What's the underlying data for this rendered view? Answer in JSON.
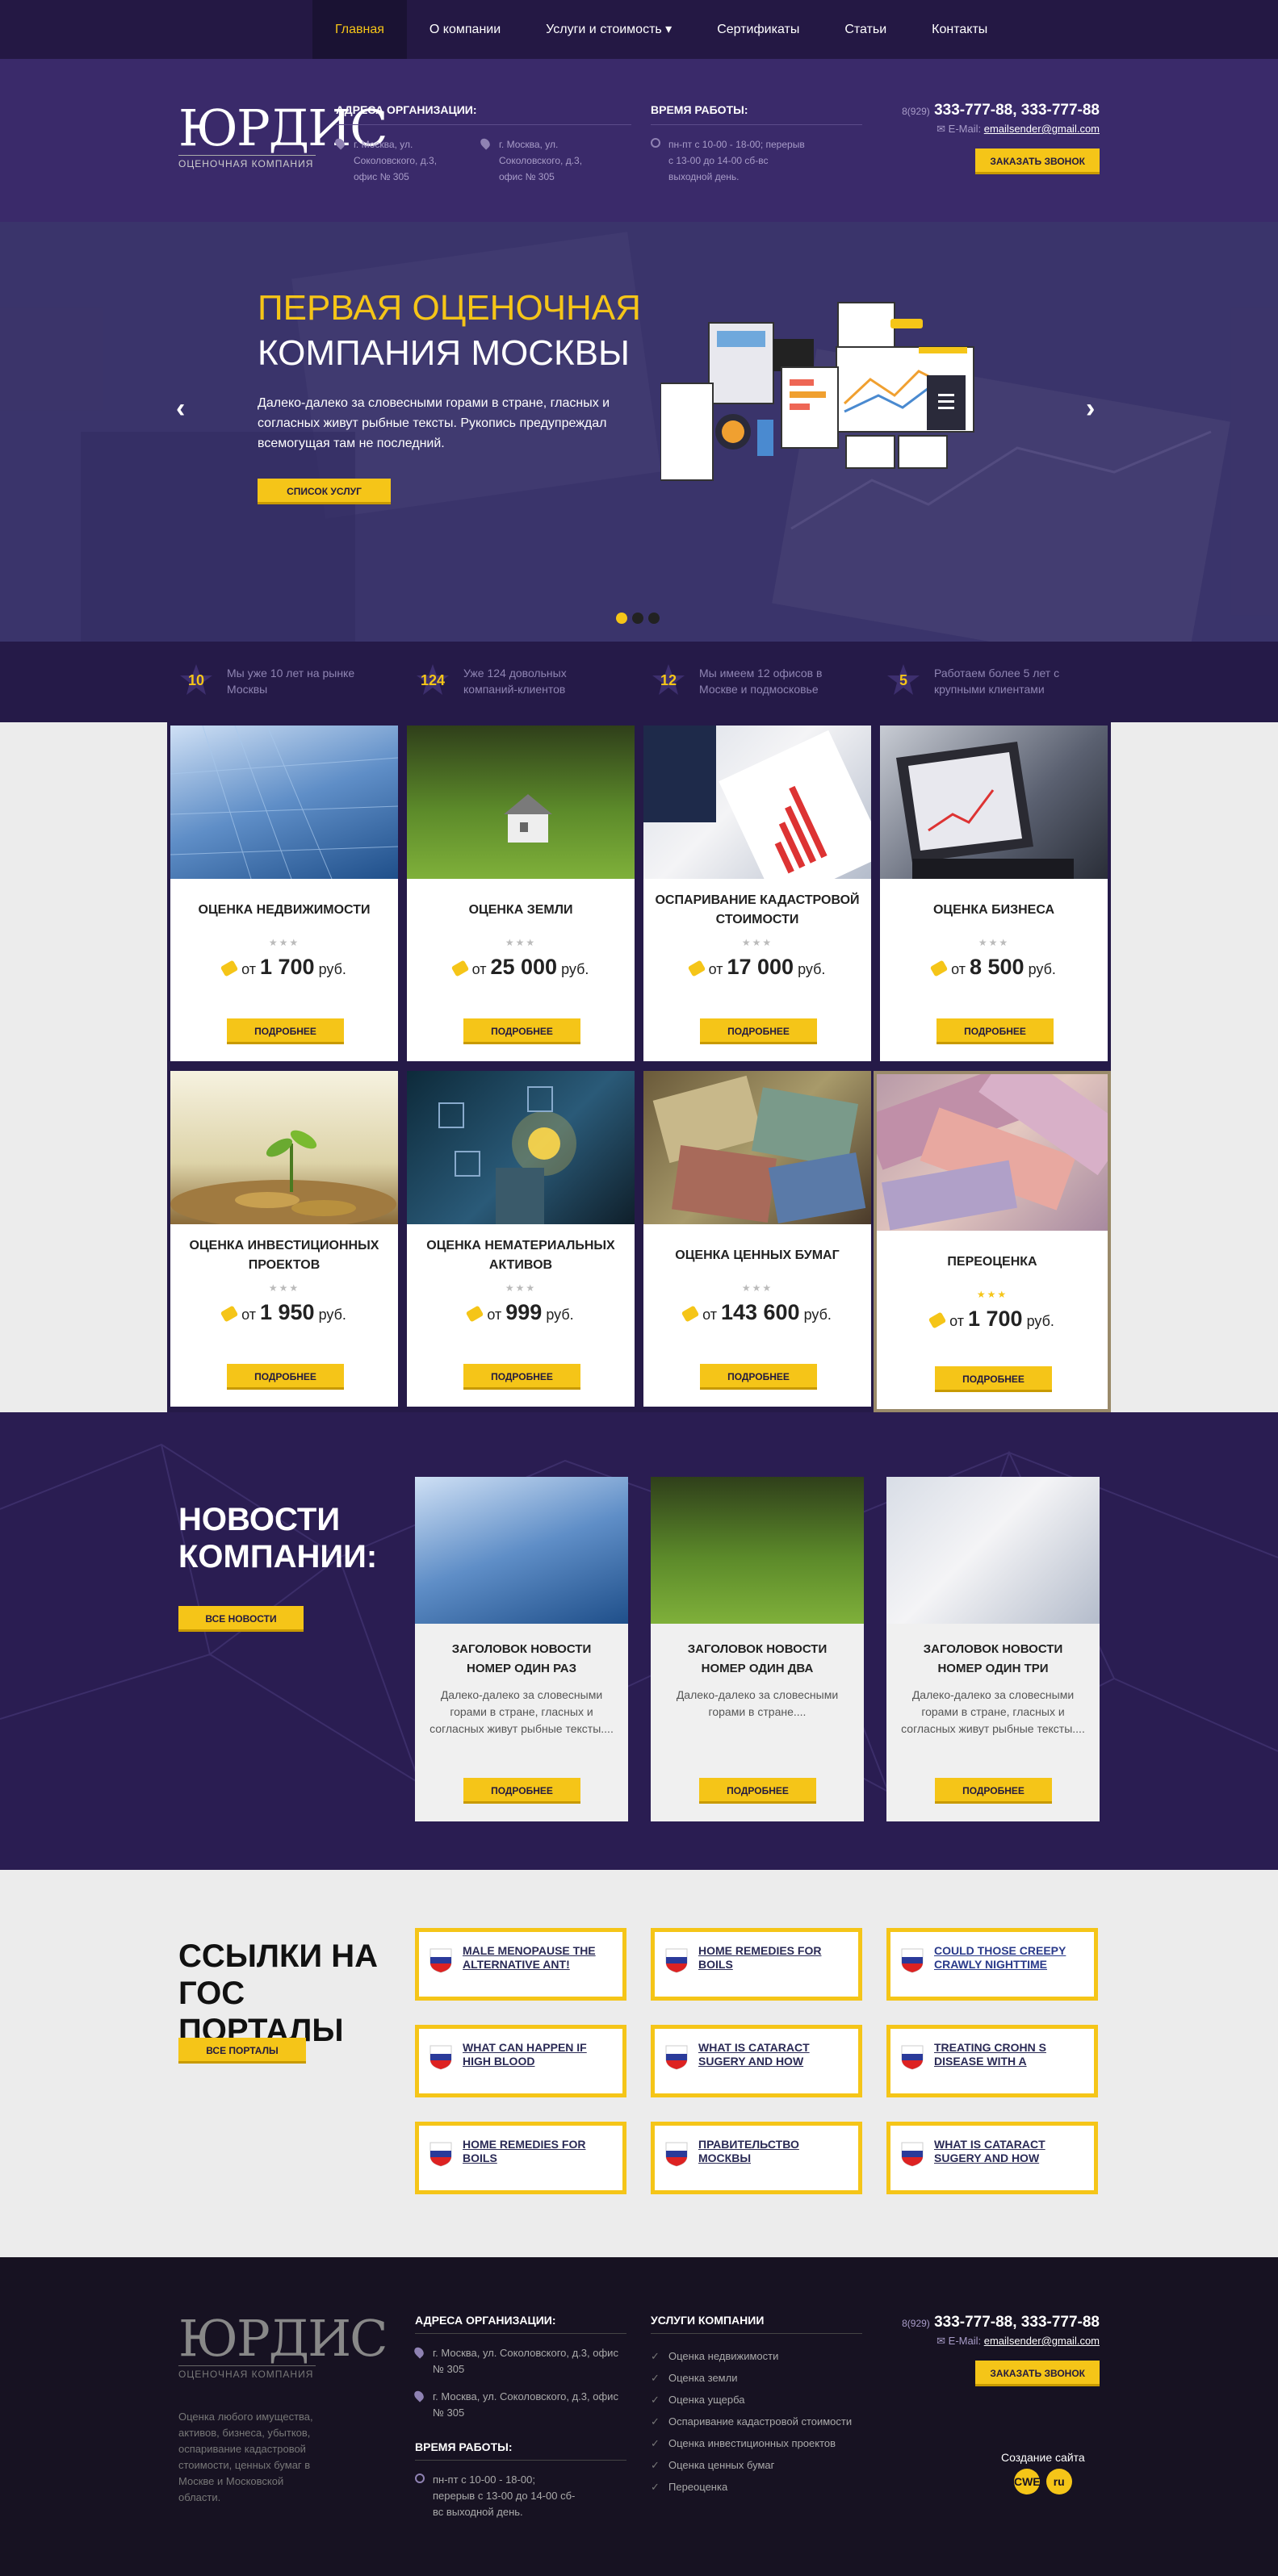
{
  "nav": {
    "items": [
      {
        "label": "Главная"
      },
      {
        "label": "О компании"
      },
      {
        "label": "Услуги и стоимость ▾"
      },
      {
        "label": "Сертификаты"
      },
      {
        "label": "Статьи"
      },
      {
        "label": "Контакты"
      }
    ]
  },
  "header": {
    "logo_mark": "ЮРДИС",
    "logo_sub": "ОЦЕНОЧНАЯ КОМПАНИЯ",
    "addr_title": "АДРЕСА ОРГАНИЗАЦИИ:",
    "addr1": "г. Москва, ул. Соколовского, д.3, офис № 305",
    "addr2": "г. Москва, ул. Соколовского, д.3, офис № 305",
    "hours_title": "ВРЕМЯ РАБОТЫ:",
    "hours": "пн-пт с 10-00 - 18-00; перерыв с 13-00 до 14-00 сб-вс выходной день.",
    "phone_code": "8(929)",
    "phone": "333-777-88, 333-777-88",
    "email_label": "E-Mail:",
    "email": "emailsender@gmail.com",
    "call_btn": "ЗАКАЗАТЬ ЗВОНОК"
  },
  "hero": {
    "title1": "ПЕРВАЯ ОЦЕНОЧНАЯ",
    "title2": "КОМПАНИЯ МОСКВЫ",
    "text": "Далеко-далеко за словесными горами в стране, гласных и согласных живут рыбные тексты. Рукопись предупреждал всемогущая там не последний.",
    "btn": "СПИСОК УСЛУГ",
    "prev": "‹",
    "next": "›"
  },
  "stats": [
    {
      "num": "10",
      "text": "Мы уже 10 лет на рынке Москвы"
    },
    {
      "num": "124",
      "text": "Уже 124 довольных компаний-клиентов"
    },
    {
      "num": "12",
      "text": "Мы имеем 12 офисов в Москве и подмосковье"
    },
    {
      "num": "5",
      "text": "Работаем более 5 лет с крупными клиентами"
    }
  ],
  "services": [
    {
      "title": "ОЦЕНКА НЕДВИЖИМОСТИ",
      "price": "1 700",
      "btn": "ПОДРОБНЕЕ"
    },
    {
      "title": "ОЦЕНКА ЗЕМЛИ",
      "price": "25 000",
      "btn": "ПОДРОБНЕЕ"
    },
    {
      "title": "ОСПАРИВАНИЕ КАДАСТРОВОЙ СТОИМОСТИ",
      "price": "17 000",
      "btn": "ПОДРОБНЕЕ"
    },
    {
      "title": "ОЦЕНКА БИЗНЕСА",
      "price": "8 500",
      "btn": "ПОДРОБНЕЕ"
    },
    {
      "title": "ОЦЕНКА ИНВЕСТИЦИОННЫХ ПРОЕКТОВ",
      "price": "1 950",
      "btn": "ПОДРОБНЕЕ"
    },
    {
      "title": "ОЦЕНКА НЕМАТЕРИАЛЬНЫХ АКТИВОВ",
      "price": "999",
      "btn": "ПОДРОБНЕЕ"
    },
    {
      "title": "ОЦЕНКА ЦЕННЫХ БУМАГ",
      "price": "143 600",
      "btn": "ПОДРОБНЕЕ"
    },
    {
      "title": "ПЕРЕОЦЕНКА",
      "price": "1 700",
      "btn": "ПОДРОБНЕЕ"
    }
  ],
  "price_from": "от",
  "price_unit": "руб.",
  "stars": "★★★",
  "news": {
    "title": "НОВОСТИ КОМПАНИИ:",
    "all_btn": "ВСЕ НОВОСТИ",
    "items": [
      {
        "title": "ЗАГОЛОВОК НОВОСТИ НОМЕР ОДИН РАЗ",
        "text": "Далеко-далеко за словесными горами в стране, гласных и согласных живут рыбные тексты....",
        "btn": "ПОДРОБНЕЕ"
      },
      {
        "title": "ЗАГОЛОВОК НОВОСТИ НОМЕР ОДИН ДВА",
        "text": "Далеко-далеко за словесными горами в стране....",
        "btn": "ПОДРОБНЕЕ"
      },
      {
        "title": "ЗАГОЛОВОК НОВОСТИ НОМЕР ОДИН ТРИ",
        "text": "Далеко-далеко за словесными горами в стране, гласных и согласных живут рыбные тексты....",
        "btn": "ПОДРОБНЕЕ"
      }
    ]
  },
  "links": {
    "title": "ССЫЛКИ НА ГОС ПОРТАЛЫ",
    "all_btn": "ВСЕ ПОРТАЛЫ",
    "items": [
      "MALE MENOPAUSE THE ALTERNATIVE ANT!",
      "HOME REMEDIES FOR BOILS",
      "COULD THOSE CREEPY CRAWLY NIGHTTIME",
      "WHAT CAN HAPPEN IF HIGH BLOOD",
      "WHAT IS CATARACT SUGERY AND HOW",
      "TREATING CROHN S DISEASE WITH A",
      "HOME REMEDIES FOR BOILS",
      "ПРАВИТЕЛЬСТВО МОСКВЫ",
      "WHAT IS CATARACT SUGERY AND HOW"
    ]
  },
  "footer": {
    "desc": "Оценка любого имущества, активов, бизнеса, убытков, оспаривание кадастровой стоимости, ценных бумаг в Москве и Московской области.",
    "addr_title": "АДРЕСА ОРГАНИЗАЦИИ:",
    "addr1": "г. Москва, ул. Соколовского, д.3, офис № 305",
    "addr2": "г. Москва, ул. Соколовского, д.3, офис № 305",
    "hours_title": "ВРЕМЯ РАБОТЫ:",
    "hours": "пн-пт с 10-00 - 18-00; перерыв с 13-00 до 14-00 сб-вс выходной день.",
    "services_title": "УСЛУГИ КОМПАНИИ",
    "services": [
      "Оценка недвижимости",
      "Оценка земли",
      "Оценка ущерба",
      "Оспаривание кадастровой стоимости",
      "Оценка инвестиционных проектов",
      "Оценка ценных бумаг",
      "Переоценка"
    ],
    "cwebs_a": "Создание сайта",
    "cwebs_b": "CWEBS",
    "cwebs_c": "ru"
  }
}
